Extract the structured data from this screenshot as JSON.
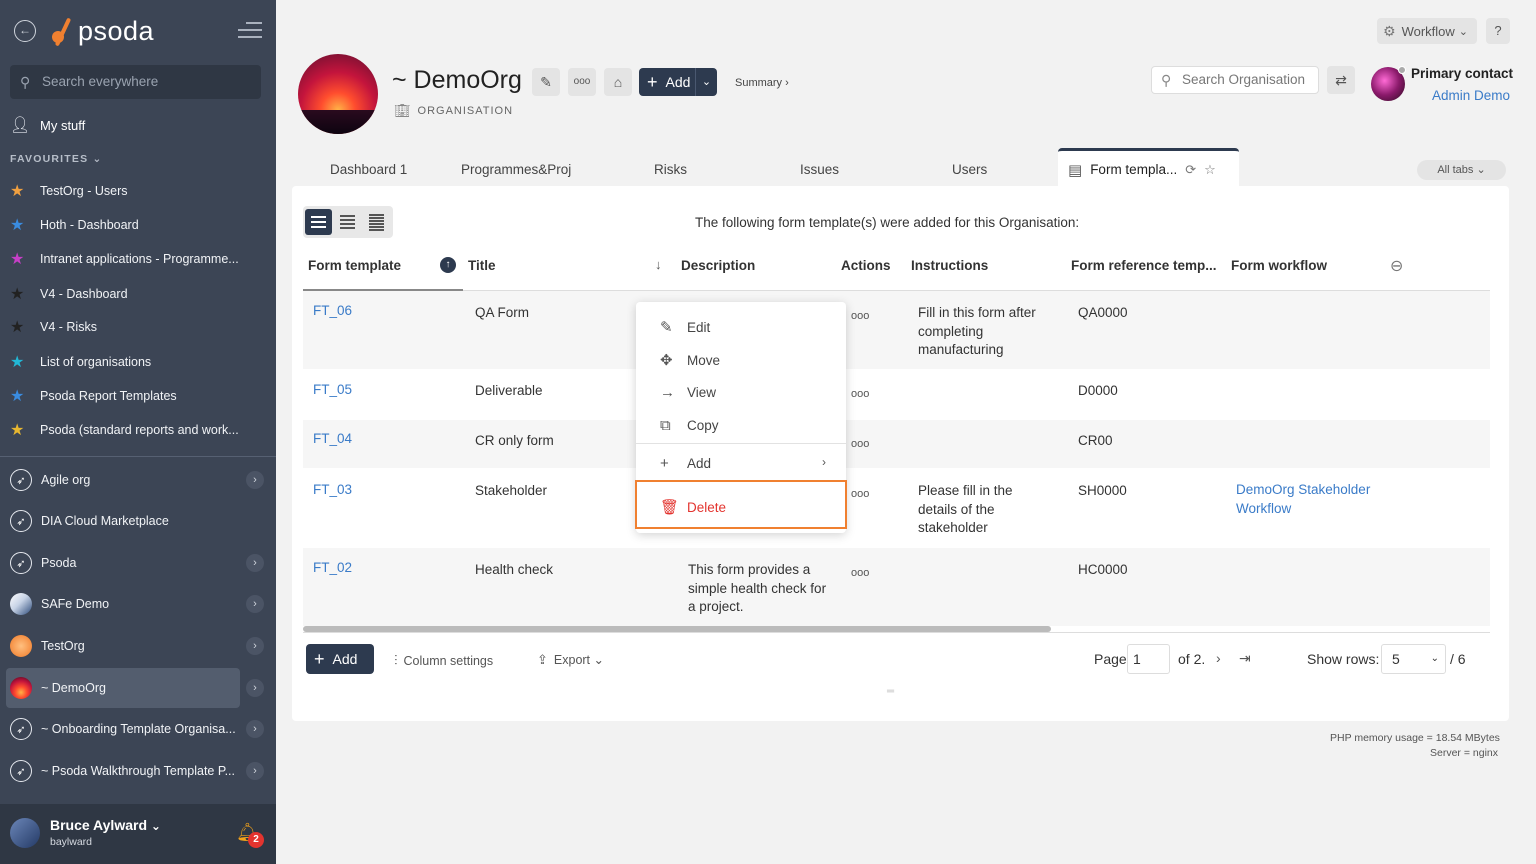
{
  "sidebar": {
    "search_placeholder": "Search everywhere",
    "my_stuff": "My stuff",
    "favourites_head": "FAVOURITES",
    "favourites": [
      {
        "label": "TestOrg - Users",
        "color": "#f0a040"
      },
      {
        "label": "Hoth - Dashboard",
        "color": "#3a8ce0"
      },
      {
        "label": "Intranet applications - Programme...",
        "color": "#c63fc7"
      },
      {
        "label": "V4 - Dashboard",
        "color": "#222222"
      },
      {
        "label": "V4 - Risks",
        "color": "#222222"
      },
      {
        "label": "List of organisations",
        "color": "#22b8d6"
      },
      {
        "label": "Psoda Report Templates",
        "color": "#3a8ce0"
      },
      {
        "label": "Psoda (standard reports and work...",
        "color": "#e8b730"
      }
    ],
    "orgs": [
      {
        "label": "Agile org"
      },
      {
        "label": "DIA Cloud Marketplace"
      },
      {
        "label": "Psoda"
      },
      {
        "label": "SAFe Demo"
      },
      {
        "label": "TestOrg"
      },
      {
        "label": "~ DemoOrg"
      },
      {
        "label": "~ Onboarding Template Organisa..."
      },
      {
        "label": "~ Psoda Walkthrough Template P..."
      }
    ],
    "user": {
      "name": "Bruce Aylward",
      "username": "baylward",
      "notifications": "2"
    }
  },
  "logo": "psoda",
  "topbar": {
    "workflow": "Workflow",
    "help": "?"
  },
  "header": {
    "title": "~ DemoOrg",
    "subtitle": "ORGANISATION",
    "add": "Add",
    "summary": "Summary ›",
    "search_placeholder": "Search Organisation",
    "contact_label": "Primary contact",
    "contact_name": "Admin Demo"
  },
  "tabs": {
    "items": [
      "Dashboard 1",
      "Programmes&Proj",
      "Risks",
      "Issues",
      "Users"
    ],
    "active": "Form templa...",
    "all_tabs": "All tabs"
  },
  "table": {
    "intro": "The following form template(s) were added for this Organisation:",
    "headers": [
      "Form template",
      "Title",
      "Description",
      "Actions",
      "Instructions",
      "Form reference temp...",
      "Form workflow"
    ],
    "rows": [
      {
        "id": "FT_06",
        "title": "QA Form",
        "description": "",
        "instructions": "Fill in this form after completing manufacturing",
        "reference": "QA0000",
        "workflow": ""
      },
      {
        "id": "FT_05",
        "title": "Deliverable",
        "description": "",
        "instructions": "",
        "reference": "D0000",
        "workflow": ""
      },
      {
        "id": "FT_04",
        "title": "CR only form",
        "description": "",
        "instructions": "",
        "reference": "CR00",
        "workflow": ""
      },
      {
        "id": "FT_03",
        "title": "Stakeholder",
        "description": "",
        "instructions": "Please fill in the details of the stakeholder",
        "reference": "SH0000",
        "workflow": "DemoOrg Stakeholder Workflow"
      },
      {
        "id": "FT_02",
        "title": "Health check",
        "description": "This form provides a simple health check for a project.",
        "instructions": "",
        "reference": "HC0000",
        "workflow": ""
      }
    ],
    "actions_glyph": "ooo"
  },
  "context_menu": {
    "items": [
      "Edit",
      "Move",
      "View",
      "Copy",
      "Add"
    ],
    "delete": "Delete"
  },
  "footer": {
    "add": "Add",
    "column_settings": "Column settings",
    "export": "Export",
    "page_label": "Page",
    "page_value": "1",
    "page_of": "of 2.",
    "rows_label": "Show rows:",
    "rows_value": "5",
    "rows_total": "/ 6"
  },
  "server_info": {
    "memory": "PHP memory usage = 18.54 MBytes",
    "server": "Server = nginx"
  }
}
